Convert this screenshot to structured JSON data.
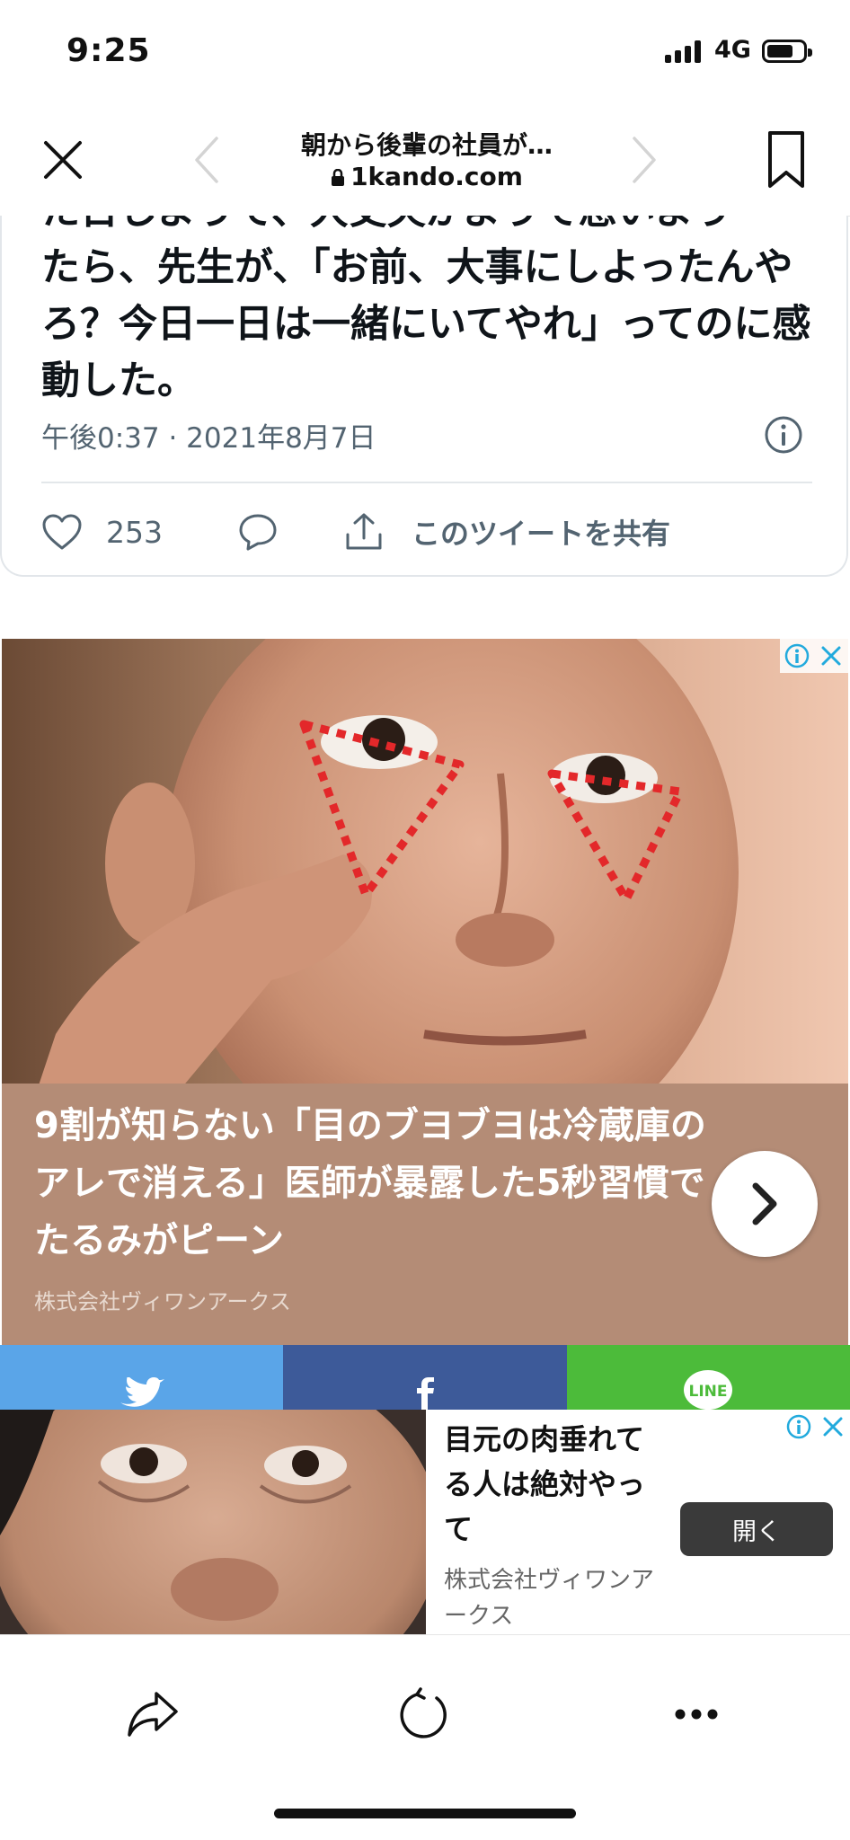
{
  "status_bar": {
    "time": "9:25",
    "network": "4G"
  },
  "nav": {
    "page_title": "朝から後輩の社員が…",
    "url": "1kando.com",
    "icons": {
      "close": "close-icon",
      "back": "chevron-left-icon",
      "forward": "chevron-right-icon",
      "bookmark": "bookmark-icon",
      "lock": "lock-icon"
    }
  },
  "tweet": {
    "text_partial_top": "た日しようて、大丈夫がようて息いよう",
    "text_lines": [
      "たら、先生が、「お前、大事にしよったんやろ？今日一日は一緒にいてやれ」ってのに感動した。"
    ],
    "timestamp": "午後0:37 · 2021年8月7日",
    "like_count": "253",
    "share_label": "このツイートを共有",
    "icons": {
      "info": "info-icon",
      "like": "heart-icon",
      "reply": "reply-icon",
      "share": "share-icon"
    }
  },
  "ad1": {
    "headline": "9割が知らない「目のブヨブヨは冷蔵庫のアレで消える」医師が暴露した5秒習慣でたるみがピーン",
    "sponsor": "株式会社ヴィワンアークス",
    "icons": {
      "arrow": "chevron-right-icon",
      "adinfo": "ad-info-icon",
      "close": "ad-close-icon"
    }
  },
  "share_bar": {
    "items": [
      {
        "service": "twitter",
        "icon": "twitter-icon",
        "color": "#5aa5e8"
      },
      {
        "service": "facebook",
        "icon": "facebook-icon",
        "color": "#3d5a99"
      },
      {
        "service": "line",
        "icon": "line-icon",
        "label": "LINE",
        "color": "#4cbb3a"
      }
    ]
  },
  "ad2": {
    "text": "目元の肉垂れてる人は絶対やって",
    "sponsor": "株式会社ヴィワンアークス",
    "button_label": "開く"
  },
  "toolbar": {
    "icons": {
      "share": "share-arrow-icon",
      "reload": "reload-icon",
      "more": "more-icon"
    }
  }
}
